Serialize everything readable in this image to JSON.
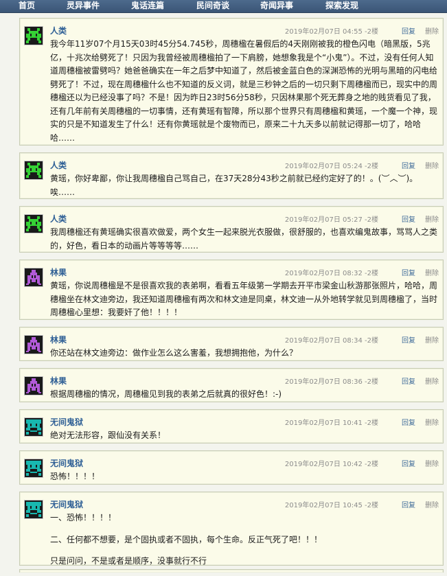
{
  "nav": [
    "首页",
    "灵异事件",
    "鬼话连篇",
    "民间奇谈",
    "奇闻异事",
    "探索发现"
  ],
  "actions": {
    "reply": "回复",
    "delete": "删除"
  },
  "posts": [
    {
      "author": "人类",
      "avatar": "green-invader",
      "time": "2019年02月07日 04:55",
      "floor": "-2楼",
      "paragraphs": [
        "我今年11岁07个月15天03时45分54.745秒，周穗楹在暑假后的4天刚刚被我的橙色闪电（暗黑版，5兆亿，十兆次给劈死了！只因为我曾经被周穗楹拍了一下肩膀，她想象我是个“小鬼”）。不过，没有任何人知道周穗楹被雷劈吗？她爸爸确实在一年之后梦中知道了，然后被金蓝白色的深渊恐怖的光明与黑暗的闪电给劈死了！不过，现在周穗楹什么也不知道的反义词，就是三秒钟之后的一切只剩下周穗楹而已，现实中的周穗楹还以为已经没事了吗？不是！因为昨日23时56分58秒，只因林果那个死无葬身之地的贱货看见了我，还有几年前有关周穗楹的一切事情，还有黄瑶有智障，所以那个世界只有周穗楹和黄瑶，一个魔一个神，现实的只是不知道发生了什么！还有你黄瑶就是个废物而已，原来二十九天多以前就记得那一切了，哈哈哈……"
      ]
    },
    {
      "author": "人类",
      "avatar": "green-invader",
      "time": "2019年02月07日 05:24",
      "floor": "-2楼",
      "paragraphs": [
        "黄瑶，你好卑鄙，你让我周穗楹自己骂自己，在37天28分43秒之前就已经约定好了的！。(︶︿︶)。唉……"
      ]
    },
    {
      "author": "人类",
      "avatar": "green-invader",
      "time": "2019年02月07日 05:27",
      "floor": "-2楼",
      "paragraphs": [
        "我周穗楹还有黄瑶确实很喜欢做爱，两个女生一起来脱光衣服做，很舒服的，也喜欢编鬼故事，骂骂人之类的，好色，看日本的动画片等等等等……"
      ]
    },
    {
      "author": "林果",
      "avatar": "purple-invader",
      "time": "2019年02月07日 08:32",
      "floor": "-2楼",
      "paragraphs": [
        "黄瑶，你说周穗楹是不是很喜欢我的表弟啊，看看五年级第一学期去开平市梁金山秋游那张照片，哈哈，周穗楹坐在林文迪旁边，我还知道周穗楹有两次和林文迪是同桌，林文迪一从外地转学就见到周穗楹了，当时周穗楹心里想：我要奸了他！！！！"
      ]
    },
    {
      "author": "林果",
      "avatar": "purple-invader",
      "time": "2019年02月07日 08:34",
      "floor": "-2楼",
      "paragraphs": [
        "你还站在林文迪旁边：做作业怎么这么害羞，我想拥抱他，为什么？"
      ]
    },
    {
      "author": "林果",
      "avatar": "purple-invader",
      "time": "2019年02月07日 08:36",
      "floor": "-2楼",
      "paragraphs": [
        "根据周穗楹的情况，周穗楹见到我的表弟之后就真的很好色！:-)"
      ]
    },
    {
      "author": "无间鬼狱",
      "avatar": "teal-invader",
      "time": "2019年02月07日 10:41",
      "floor": "-2楼",
      "paragraphs": [
        "绝对无法形容，跟仙没有关系！"
      ]
    },
    {
      "author": "无间鬼狱",
      "avatar": "teal-invader",
      "time": "2019年02月07日 10:42",
      "floor": "-2楼",
      "paragraphs": [
        "恐怖！！！！"
      ]
    },
    {
      "author": "无间鬼狱",
      "avatar": "teal-invader",
      "time": "2019年02月07日 10:45",
      "floor": "-2楼",
      "paragraphs": [
        "一、恐怖！！！！",
        "二、任何都不想要，是个固执或者不固执，每个生命。反正气死了吧！！！",
        "只是问问，不是或者是顺序，没事就行不行"
      ]
    }
  ],
  "colors": {
    "nav_bg": "#3f5b7d",
    "post_bg": "#fbfbe9",
    "author": "#2e5f95",
    "green_invader": "#35d235",
    "purple_invader": "#b25ad8",
    "teal_invader": "#18b8b0"
  }
}
